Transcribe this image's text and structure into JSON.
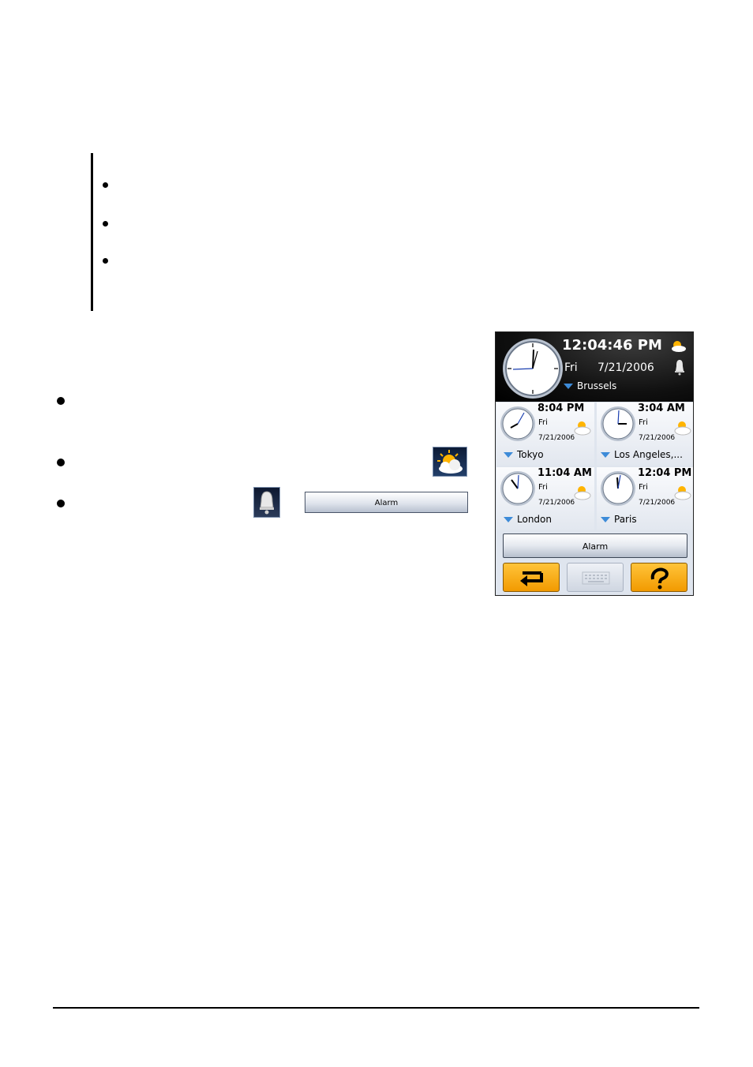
{
  "inline": {
    "alarm_button_label": "Alarm",
    "weather_icon": "partly-cloudy-icon",
    "bell_icon": "bell-icon"
  },
  "device": {
    "main": {
      "time": "12:04:46 PM",
      "day": "Fri",
      "date": "7/21/2006",
      "city": "Brussels"
    },
    "cities": [
      {
        "time": "8:04 PM",
        "day": "Fri",
        "date": "7/21/2006",
        "city": "Tokyo"
      },
      {
        "time": "3:04 AM",
        "day": "Fri",
        "date": "7/21/2006",
        "city": "Los Angeles,..."
      },
      {
        "time": "11:04 AM",
        "day": "Fri",
        "date": "7/21/2006",
        "city": "London"
      },
      {
        "time": "12:04 PM",
        "day": "Fri",
        "date": "7/21/2006",
        "city": "Paris"
      }
    ],
    "alarm_label": "Alarm",
    "nav": {
      "back_icon": "return-arrow-icon",
      "keyboard_icon": "keyboard-icon",
      "help_icon": "help-icon"
    }
  },
  "colors": {
    "accent_orange": "#f5a300",
    "city_arrow": "#3d8bd8",
    "header_dark": "#0a0a0a"
  }
}
